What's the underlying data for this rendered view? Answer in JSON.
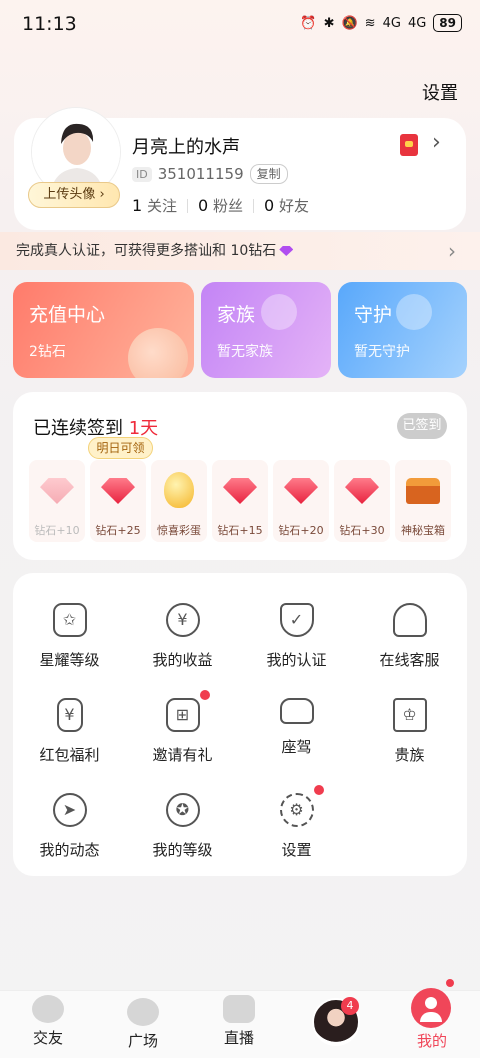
{
  "status_bar": {
    "time": "11:13",
    "signal_labels": [
      "4G",
      "4G"
    ],
    "battery": "89"
  },
  "header": {
    "settings_label": "设置"
  },
  "profile": {
    "username": "月亮上的水声",
    "id_tag": "ID",
    "id_value": "351011159",
    "copy_label": "复制",
    "upload_avatar_label": "上传头像",
    "follow_count": "1",
    "follow_label": "关注",
    "fans_count": "0",
    "fans_label": "粉丝",
    "friends_count": "0",
    "friends_label": "好友"
  },
  "verify_banner": {
    "text": "完成真人认证，可获得更多搭讪和 10钻石"
  },
  "cards": [
    {
      "title": "充值中心",
      "sub": "2钻石"
    },
    {
      "title": "家族",
      "sub": "暂无家族"
    },
    {
      "title": "守护",
      "sub": "暂无守护"
    }
  ],
  "signin": {
    "title_prefix": "已连续签到",
    "streak": "1天",
    "signed_label": "已签到",
    "tomorrow_label": "明日可领",
    "days": [
      {
        "label": "钻石+10",
        "icon": "diamond-icon"
      },
      {
        "label": "钻石+25",
        "icon": "diamond-icon"
      },
      {
        "label": "惊喜彩蛋",
        "icon": "egg-icon"
      },
      {
        "label": "钻石+15",
        "icon": "diamond-icon"
      },
      {
        "label": "钻石+20",
        "icon": "diamond-icon"
      },
      {
        "label": "钻石+30",
        "icon": "diamond-icon"
      },
      {
        "label": "神秘宝箱",
        "icon": "chest-icon"
      }
    ]
  },
  "menu": [
    {
      "label": "星耀等级",
      "icon": "star-badge-icon"
    },
    {
      "label": "我的收益",
      "icon": "yen-icon"
    },
    {
      "label": "我的认证",
      "icon": "shield-check-icon"
    },
    {
      "label": "在线客服",
      "icon": "headset-icon"
    },
    {
      "label": "红包福利",
      "icon": "red-packet-icon"
    },
    {
      "label": "邀请有礼",
      "icon": "gift-icon"
    },
    {
      "label": "座驾",
      "icon": "car-icon"
    },
    {
      "label": "贵族",
      "icon": "crown-icon"
    },
    {
      "label": "我的动态",
      "icon": "compass-icon"
    },
    {
      "label": "我的等级",
      "icon": "medal-icon"
    },
    {
      "label": "设置",
      "icon": "gear-icon"
    }
  ],
  "bottom_nav": [
    {
      "label": "交友",
      "icon": "heart-icon"
    },
    {
      "label": "广场",
      "icon": "compass-icon"
    },
    {
      "label": "直播",
      "icon": "video-icon"
    },
    {
      "label": "我的",
      "icon": "user-icon"
    }
  ],
  "messages_badge": "4",
  "colors": {
    "accent": "#f04659",
    "streak": "#ef2b3b"
  }
}
